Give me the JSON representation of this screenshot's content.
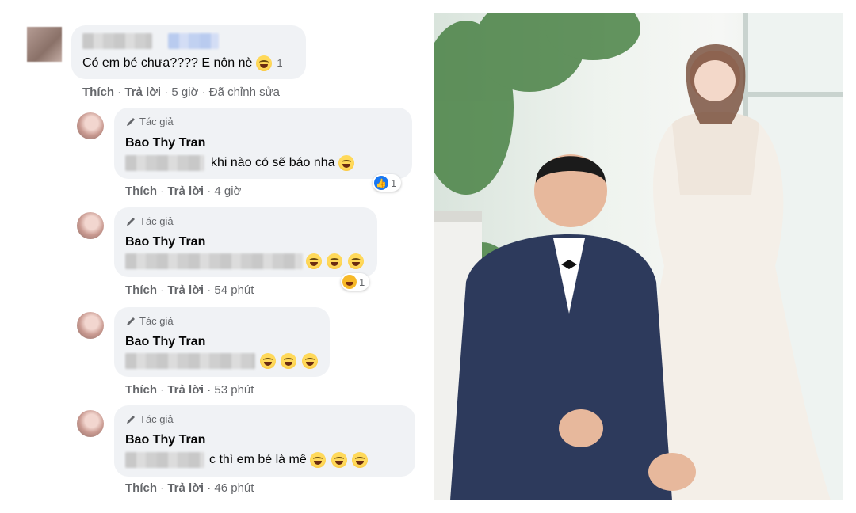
{
  "comments": [
    {
      "text": "Có em bé chưa???? E nôn nè",
      "reaction_count": "1",
      "actions": {
        "like": "Thích",
        "reply": "Trả lời",
        "time": "5 giờ",
        "edited": "Đã chỉnh sửa"
      }
    },
    {
      "author_badge": "Tác giả",
      "name": "Bao Thy Tran",
      "text": "khi nào có sẽ báo nha",
      "reaction_count": "1",
      "actions": {
        "like": "Thích",
        "reply": "Trả lời",
        "time": "4 giờ"
      }
    },
    {
      "author_badge": "Tác giả",
      "name": "Bao Thy Tran",
      "reaction_count": "1",
      "actions": {
        "like": "Thích",
        "reply": "Trả lời",
        "time": "54 phút"
      }
    },
    {
      "author_badge": "Tác giả",
      "name": "Bao Thy Tran",
      "actions": {
        "like": "Thích",
        "reply": "Trả lời",
        "time": "53 phút"
      }
    },
    {
      "author_badge": "Tác giả",
      "name": "Bao Thy Tran",
      "text": "c thì em bé là mê",
      "actions": {
        "like": "Thích",
        "reply": "Trả lời",
        "time": "46 phút"
      }
    }
  ],
  "colors": {
    "bubble": "#f0f2f5",
    "meta": "#65676b",
    "like_blue": "#1877f2",
    "haha": "#f7b928"
  }
}
